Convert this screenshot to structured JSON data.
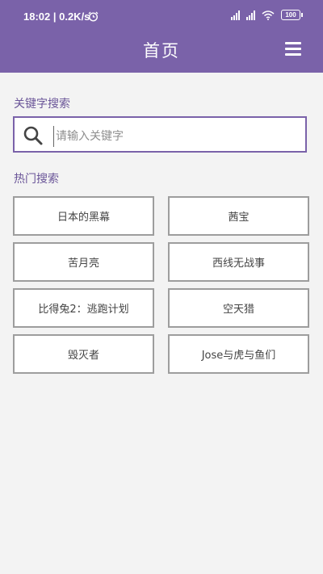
{
  "status_bar": {
    "time": "18:02 | 0.2K/s",
    "battery": "100"
  },
  "header": {
    "title": "首页"
  },
  "search": {
    "section_label": "关键字搜索",
    "placeholder": "请输入关键字"
  },
  "hot": {
    "section_label": "热门搜索",
    "items": [
      "日本的黑幕",
      "茜宝",
      "苦月亮",
      "西线无战事",
      "比得兔2：逃跑计划",
      "空天猎",
      "毁灭者",
      "Jose与虎与鱼们"
    ]
  },
  "colors": {
    "accent": "#7a62a9",
    "background": "#f3f3f3"
  },
  "icons": [
    "alarm-icon",
    "signal-icon",
    "wifi-icon",
    "battery-icon",
    "menu-icon",
    "search-icon"
  ]
}
